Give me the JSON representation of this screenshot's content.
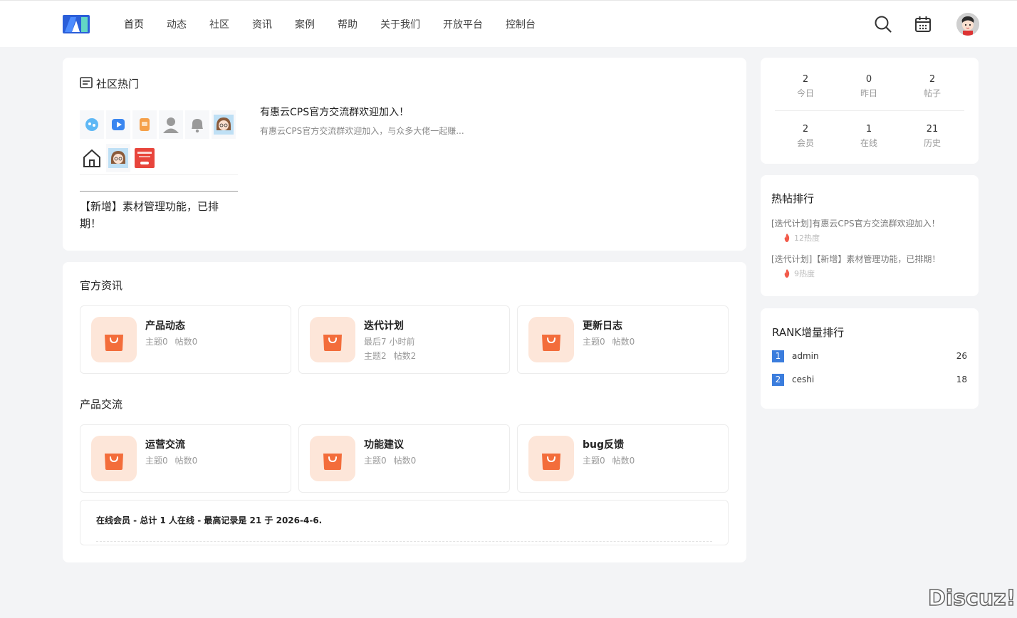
{
  "header": {
    "logo_text": "AI",
    "nav": [
      "首页",
      "动态",
      "社区",
      "资讯",
      "案例",
      "帮助",
      "关于我们",
      "开放平台",
      "控制台"
    ],
    "active_index": 0,
    "icons": [
      "search-icon",
      "calendar-icon",
      "avatar"
    ]
  },
  "hot": {
    "title": "社区热门",
    "caption": "【新增】素材管理功能，已排期！",
    "link_title": "有惠云CPS官方交流群欢迎加入！",
    "link_desc": "有惠云CPS官方交流群欢迎加入，与众多大佬一起赚..."
  },
  "official": {
    "title": "官方资讯",
    "forums": [
      {
        "name": "产品动态",
        "lines": [
          [
            "主题0",
            "帖数0"
          ]
        ]
      },
      {
        "name": "迭代计划",
        "lines": [
          [
            "最后7 小时前"
          ],
          [
            "主题2",
            "帖数2"
          ]
        ]
      },
      {
        "name": "更新日志",
        "lines": [
          [
            "主题0",
            "帖数0"
          ]
        ]
      }
    ]
  },
  "exchange": {
    "title": "产品交流",
    "forums": [
      {
        "name": "运营交流",
        "lines": [
          [
            "主题0",
            "帖数0"
          ]
        ]
      },
      {
        "name": "功能建议",
        "lines": [
          [
            "主题0",
            "帖数0"
          ]
        ]
      },
      {
        "name": "bug反馈",
        "lines": [
          [
            "主题0",
            "帖数0"
          ]
        ]
      }
    ]
  },
  "online": {
    "text": "在线会员 - 总计 1 人在线 - 最高记录是 21 于 2026-4-6."
  },
  "stats": [
    {
      "num": "2",
      "label": "今日"
    },
    {
      "num": "0",
      "label": "昨日"
    },
    {
      "num": "2",
      "label": "帖子"
    },
    {
      "num": "2",
      "label": "会员"
    },
    {
      "num": "1",
      "label": "在线"
    },
    {
      "num": "21",
      "label": "历史"
    }
  ],
  "hot_posts": {
    "title": "热帖排行",
    "items": [
      {
        "title": "[迭代计划]有惠云CPS官方交流群欢迎加入！",
        "heat": "12热度"
      },
      {
        "title": "[迭代计划]【新增】素材管理功能，已排期！",
        "heat": "9热度"
      }
    ]
  },
  "rank": {
    "title": "RANK增量排行",
    "items": [
      {
        "rank": "1",
        "name": "admin",
        "score": "26"
      },
      {
        "rank": "2",
        "name": "ceshi",
        "score": "18"
      }
    ]
  },
  "watermark": "Discuz!",
  "colors": {
    "accent": "#3b7ddd",
    "forum_icon_bg": "#fde6d9",
    "bag": "#f36d3b",
    "flame": "#f25a4a"
  }
}
